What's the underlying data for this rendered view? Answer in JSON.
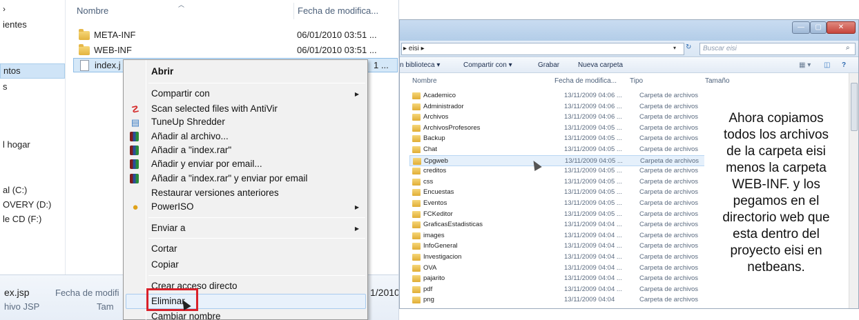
{
  "left": {
    "nav_items": [
      "ientes",
      "ntos",
      "s",
      "l hogar",
      "al (C:)",
      "OVERY (D:)",
      "le CD (F:)"
    ],
    "columns": {
      "name": "Nombre",
      "date": "Fecha de modifica..."
    },
    "files": [
      {
        "name": "META-INF",
        "date": "06/01/2010 03:51 ...",
        "icon": "folder-icon"
      },
      {
        "name": "WEB-INF",
        "date": "06/01/2010 03:51 ...",
        "icon": "folder-icon"
      },
      {
        "name": "index.j",
        "date": "1 ...",
        "icon": "document-icon"
      }
    ],
    "details": {
      "filename": "ex.jsp",
      "date_label": "Fecha de modifi",
      "type": "hivo JSP",
      "size_label": "Tam",
      "date_value": "1/2010"
    }
  },
  "context_menu": {
    "items": [
      {
        "label": "Abrir",
        "bold": true
      },
      {
        "label": "Compartir con",
        "submenu": true
      },
      {
        "label": "Scan selected files with AntiVir",
        "icon": "antivir-icon"
      },
      {
        "label": "TuneUp Shredder",
        "icon": "shredder-icon"
      },
      {
        "label": "Añadir al archivo...",
        "icon": "rar-icon"
      },
      {
        "label": "Añadir a \"index.rar\"",
        "icon": "rar-icon"
      },
      {
        "label": "Añadir y enviar por email...",
        "icon": "rar-icon"
      },
      {
        "label": "Añadir a \"index.rar\" y enviar por email",
        "icon": "rar-icon"
      },
      {
        "label": "Restaurar versiones anteriores"
      },
      {
        "label": "PowerISO",
        "icon": "poweriso-icon",
        "submenu": true
      },
      {
        "label": "Enviar a",
        "submenu": true
      },
      {
        "label": "Cortar"
      },
      {
        "label": "Copiar"
      },
      {
        "label": "Crear acceso directo"
      },
      {
        "label": "Eliminar",
        "highlighted": true
      },
      {
        "label": "Cambiar nombre"
      }
    ]
  },
  "right": {
    "address": "▸ eisi ▸",
    "search_placeholder": "Buscar eisi",
    "toolbar": [
      "n biblioteca ▾",
      "Compartir con ▾",
      "Grabar",
      "Nueva carpeta"
    ],
    "columns": {
      "name": "Nombre",
      "date": "Fecha de modifica...",
      "type": "Tipo",
      "size": "Tamaño"
    },
    "rows": [
      {
        "name": "Academico",
        "date": "13/11/2009 04:06 ...",
        "type": "Carpeta de archivos"
      },
      {
        "name": "Administrador",
        "date": "13/11/2009 04:06 ...",
        "type": "Carpeta de archivos"
      },
      {
        "name": "Archivos",
        "date": "13/11/2009 04:06 ...",
        "type": "Carpeta de archivos"
      },
      {
        "name": "ArchivosProfesores",
        "date": "13/11/2009 04:05 ...",
        "type": "Carpeta de archivos"
      },
      {
        "name": "Backup",
        "date": "13/11/2009 04:05 ...",
        "type": "Carpeta de archivos"
      },
      {
        "name": "Chat",
        "date": "13/11/2009 04:05 ...",
        "type": "Carpeta de archivos"
      },
      {
        "name": "Cpgweb",
        "date": "13/11/2009 04:05 ...",
        "type": "Carpeta de archivos",
        "selected": true
      },
      {
        "name": "creditos",
        "date": "13/11/2009 04:05 ...",
        "type": "Carpeta de archivos"
      },
      {
        "name": "css",
        "date": "13/11/2009 04:05 ...",
        "type": "Carpeta de archivos"
      },
      {
        "name": "Encuestas",
        "date": "13/11/2009 04:05 ...",
        "type": "Carpeta de archivos"
      },
      {
        "name": "Eventos",
        "date": "13/11/2009 04:05 ...",
        "type": "Carpeta de archivos"
      },
      {
        "name": "FCKeditor",
        "date": "13/11/2009 04:05 ...",
        "type": "Carpeta de archivos"
      },
      {
        "name": "GraficasEstadisticas",
        "date": "13/11/2009 04:04 ...",
        "type": "Carpeta de archivos"
      },
      {
        "name": "images",
        "date": "13/11/2009 04:04 ...",
        "type": "Carpeta de archivos"
      },
      {
        "name": "InfoGeneral",
        "date": "13/11/2009 04:04 ...",
        "type": "Carpeta de archivos"
      },
      {
        "name": "Investigacion",
        "date": "13/11/2009 04:04 ...",
        "type": "Carpeta de archivos"
      },
      {
        "name": "OVA",
        "date": "13/11/2009 04:04 ...",
        "type": "Carpeta de archivos"
      },
      {
        "name": "pajarito",
        "date": "13/11/2009 04:04 ...",
        "type": "Carpeta de archivos"
      },
      {
        "name": "pdf",
        "date": "13/11/2009 04:04 ...",
        "type": "Carpeta de archivos"
      },
      {
        "name": "png",
        "date": "13/11/2009 04:04",
        "type": "Carpeta de archivos"
      }
    ]
  },
  "annotation": {
    "lines": [
      "Ahora copiamos",
      "todos los archivos",
      "de la carpeta eisi",
      "menos la carpeta",
      "WEB-INF. y los",
      "pegamos en el",
      "directorio web que",
      "esta dentro del",
      "proyecto eisi en",
      "netbeans."
    ]
  },
  "colors": {
    "highlight_box": "#d9212b",
    "selection": "#d5e8f8",
    "titlebar": "#b3cde8",
    "close_button": "#c7463d"
  }
}
